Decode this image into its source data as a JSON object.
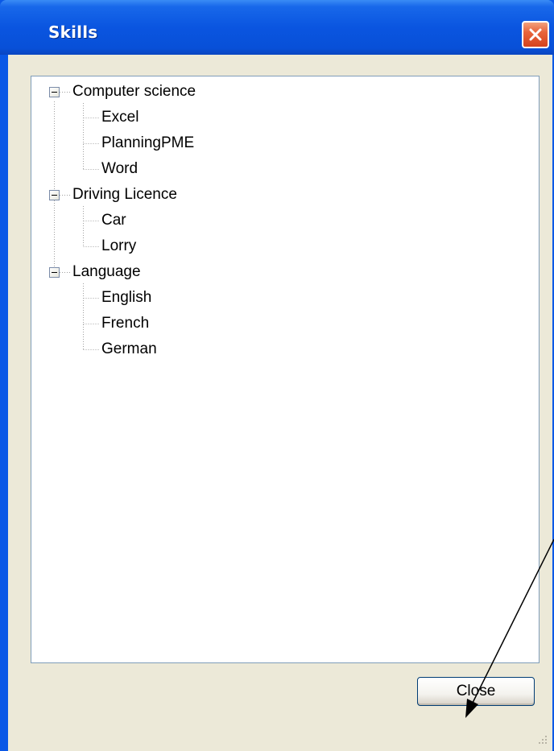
{
  "window": {
    "title": "Skills",
    "close_icon": "close-x-icon"
  },
  "tree": {
    "groups": [
      {
        "label": "Computer science",
        "expanded": true,
        "children": [
          "Excel",
          "PlanningPME",
          "Word"
        ]
      },
      {
        "label": "Driving Licence",
        "expanded": true,
        "children": [
          "Car",
          "Lorry"
        ]
      },
      {
        "label": "Language",
        "expanded": true,
        "children": [
          "English",
          "French",
          "German"
        ]
      }
    ]
  },
  "buttons": {
    "close_label": "Close"
  },
  "colors": {
    "titlebar": "#0a55e0",
    "client_bg": "#ece9d8",
    "close_x": "#e8643c",
    "tree_border": "#7f9db9"
  }
}
